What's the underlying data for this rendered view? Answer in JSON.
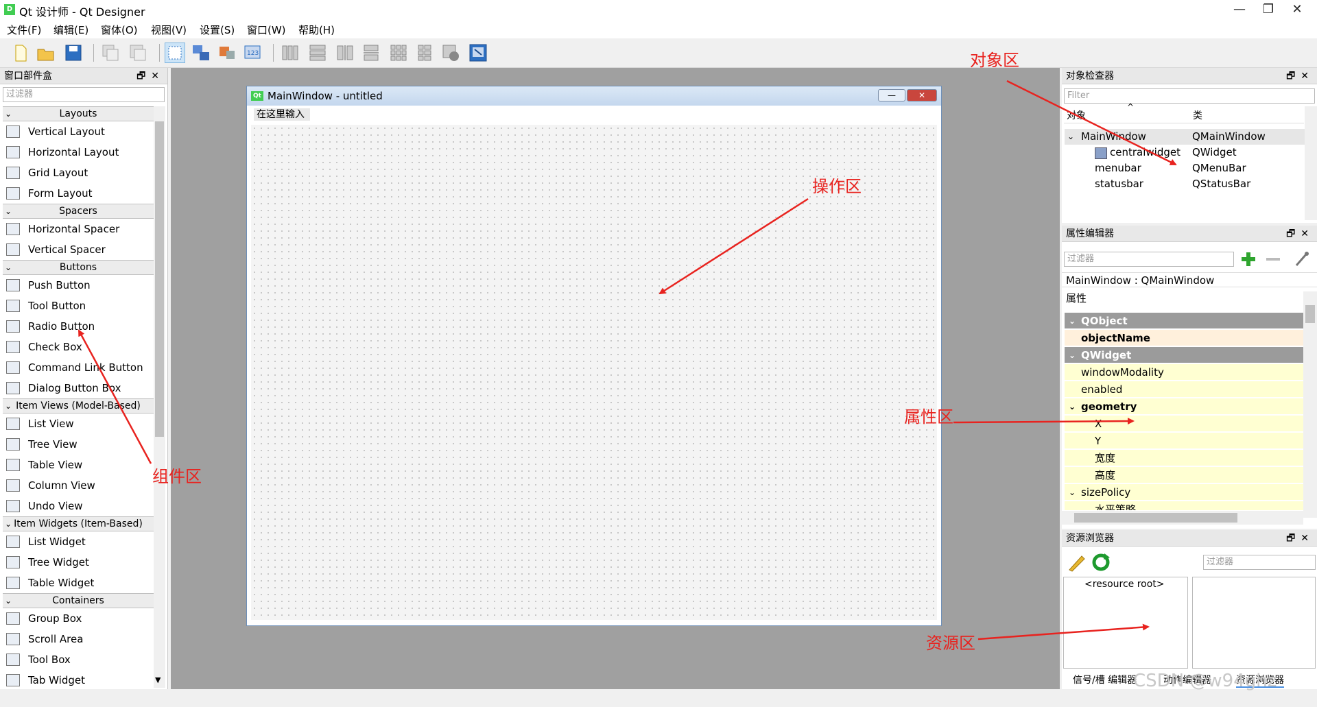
{
  "window": {
    "title": "Qt 设计师 - Qt Designer",
    "icon_text": "D",
    "controls": [
      "—",
      "❐",
      "✕"
    ]
  },
  "menubar": [
    "文件(F)",
    "编辑(E)",
    "窗体(O)",
    "视图(V)",
    "设置(S)",
    "窗口(W)",
    "帮助(H)"
  ],
  "widget_box": {
    "title": "窗口部件盒",
    "filter_placeholder": "过滤器",
    "dock_buttons": "🗗✕",
    "categories": [
      {
        "label": "Layouts",
        "items": [
          "Vertical Layout",
          "Horizontal Layout",
          "Grid Layout",
          "Form Layout"
        ]
      },
      {
        "label": "Spacers",
        "items": [
          "Horizontal Spacer",
          "Vertical Spacer"
        ]
      },
      {
        "label": "Buttons",
        "items": [
          "Push Button",
          "Tool Button",
          "Radio Button",
          "Check Box",
          "Command Link Button",
          "Dialog Button Box"
        ]
      },
      {
        "label": "Item Views (Model-Based)",
        "items": [
          "List View",
          "Tree View",
          "Table View",
          "Column View",
          "Undo View"
        ]
      },
      {
        "label": "Item Widgets (Item-Based)",
        "items": [
          "List Widget",
          "Tree Widget",
          "Table Widget"
        ]
      },
      {
        "label": "Containers",
        "items": [
          "Group Box",
          "Scroll Area",
          "Tool Box",
          "Tab Widget"
        ]
      }
    ]
  },
  "form": {
    "title": "MainWindow - untitled",
    "icon_text": "Qt",
    "menu_placeholder": "在这里输入",
    "minimize": "—",
    "close": "✕"
  },
  "object_inspector": {
    "title": "对象检查器",
    "filter_placeholder": "Filter",
    "col_object": "对象",
    "col_class": "类",
    "rows": [
      {
        "object": "MainWindow",
        "class": "QMainWindow"
      },
      {
        "object": "centralwidget",
        "class": "QWidget"
      },
      {
        "object": "menubar",
        "class": "QMenuBar"
      },
      {
        "object": "statusbar",
        "class": "QStatusBar"
      }
    ]
  },
  "property_editor": {
    "title": "属性编辑器",
    "filter_placeholder": "过滤器",
    "context": "MainWindow : QMainWindow",
    "header": "属性",
    "rows": [
      "QObject",
      "objectName",
      "QWidget",
      "windowModality",
      "enabled",
      "geometry",
      "X",
      "Y",
      "宽度",
      "高度",
      "sizePolicy",
      "水平策略"
    ]
  },
  "resource_browser": {
    "title": "资源浏览器",
    "filter_placeholder": "过滤器",
    "root": "<resource root>",
    "tabs": [
      "信号/槽 编辑器",
      "动作编辑器",
      "资源浏览器"
    ]
  },
  "annotations": {
    "object_area": "对象区",
    "operation_area": "操作区",
    "property_area": "属性区",
    "component_area": "组件区",
    "resource_area": "资源区"
  },
  "watermark": "CSDN @w94ghz",
  "colors": {
    "accent_red": "#e8231f",
    "qt_green": "#41cd52",
    "group_gray": "#9b9b9b",
    "prop_yellow": "#ffffd2"
  }
}
